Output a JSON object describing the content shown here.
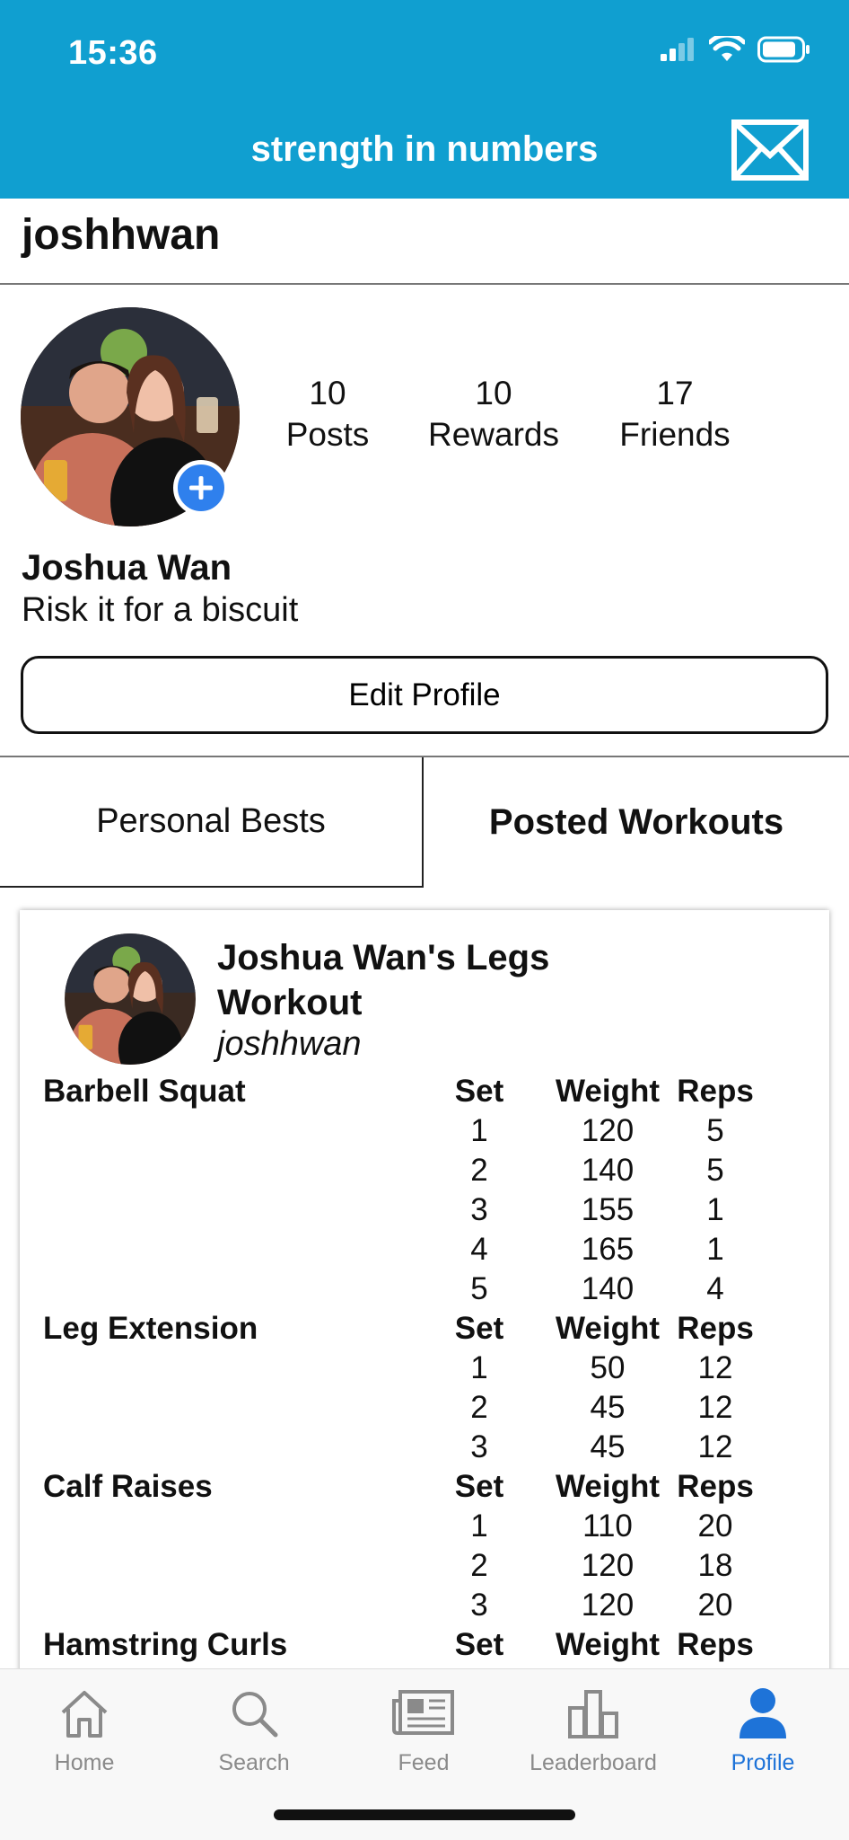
{
  "status": {
    "time": "15:36"
  },
  "header": {
    "title": "strength in numbers"
  },
  "profile": {
    "username": "joshhwan",
    "full_name": "Joshua Wan",
    "bio": "Risk it for a biscuit",
    "stats": [
      {
        "value": "10",
        "label": "Posts"
      },
      {
        "value": "10",
        "label": "Rewards"
      },
      {
        "value": "17",
        "label": "Friends"
      }
    ],
    "edit_label": "Edit Profile"
  },
  "tabs": {
    "personal_bests": "Personal Bests",
    "posted_workouts": "Posted Workouts"
  },
  "workout": {
    "title": "Joshua Wan's Legs Workout",
    "user": "joshhwan",
    "columns": {
      "set": "Set",
      "weight": "Weight",
      "reps": "Reps"
    },
    "exercises": [
      {
        "name": "Barbell Squat",
        "sets": [
          {
            "set": "1",
            "weight": "120",
            "reps": "5"
          },
          {
            "set": "2",
            "weight": "140",
            "reps": "5"
          },
          {
            "set": "3",
            "weight": "155",
            "reps": "1"
          },
          {
            "set": "4",
            "weight": "165",
            "reps": "1"
          },
          {
            "set": "5",
            "weight": "140",
            "reps": "4"
          }
        ]
      },
      {
        "name": "Leg Extension",
        "sets": [
          {
            "set": "1",
            "weight": "50",
            "reps": "12"
          },
          {
            "set": "2",
            "weight": "45",
            "reps": "12"
          },
          {
            "set": "3",
            "weight": "45",
            "reps": "12"
          }
        ]
      },
      {
        "name": "Calf Raises",
        "sets": [
          {
            "set": "1",
            "weight": "110",
            "reps": "20"
          },
          {
            "set": "2",
            "weight": "120",
            "reps": "18"
          },
          {
            "set": "3",
            "weight": "120",
            "reps": "20"
          }
        ]
      },
      {
        "name": "Hamstring Curls",
        "sets": []
      }
    ]
  },
  "nav": {
    "items": [
      {
        "label": "Home",
        "icon": "home-icon"
      },
      {
        "label": "Search",
        "icon": "search-icon"
      },
      {
        "label": "Feed",
        "icon": "newspaper-icon"
      },
      {
        "label": "Leaderboard",
        "icon": "leaderboard-icon"
      },
      {
        "label": "Profile",
        "icon": "person-icon",
        "active": true
      }
    ]
  },
  "colors": {
    "header": "#109fd0",
    "accent": "#2f80ed",
    "active_nav": "#1e73d8",
    "inactive_nav": "#8a8a8a"
  }
}
